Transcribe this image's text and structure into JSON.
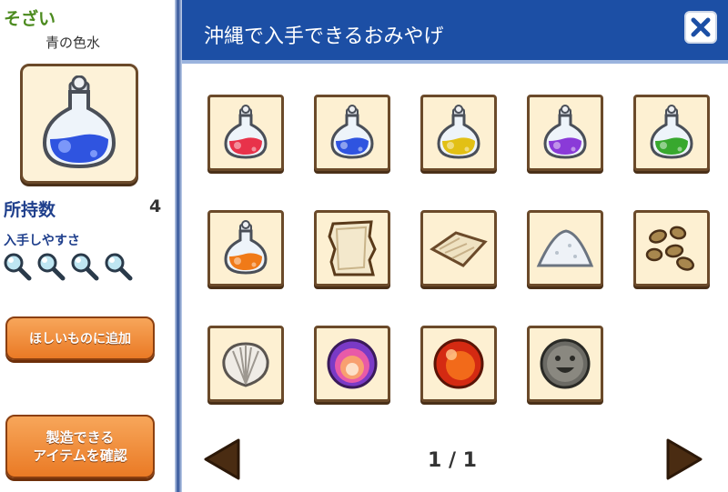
{
  "left": {
    "category": "そざい",
    "item_name": "青の色水",
    "owned_label": "所持数",
    "owned_value": "4",
    "ease_label": "入手しやすさ",
    "ease_level": 4,
    "wishlist_button": "ほしいものに追加",
    "craft_button_line1": "製造できる",
    "craft_button_line2": "アイテムを確認"
  },
  "header": {
    "title": "沖縄で入手できるおみやげ",
    "close_icon": "close-x-icon"
  },
  "items": [
    {
      "icon": "potion-red-icon",
      "color": "#e8324a"
    },
    {
      "icon": "potion-blue-icon",
      "color": "#2f54e0"
    },
    {
      "icon": "potion-yellow-icon",
      "color": "#e2c015"
    },
    {
      "icon": "potion-purple-icon",
      "color": "#8a3ad8"
    },
    {
      "icon": "potion-green-icon",
      "color": "#38a82e"
    },
    {
      "icon": "potion-orange-icon",
      "color": "#f07a18"
    },
    {
      "icon": "parchment-icon"
    },
    {
      "icon": "cloth-icon"
    },
    {
      "icon": "salt-icon"
    },
    {
      "icon": "seeds-icon"
    },
    {
      "icon": "shell-icon"
    },
    {
      "icon": "purple-stone-icon"
    },
    {
      "icon": "red-orb-icon"
    },
    {
      "icon": "smiling-rock-icon"
    }
  ],
  "pager": {
    "text": "1 / 1",
    "prev_icon": "left-arrow-icon",
    "next_icon": "right-arrow-icon"
  },
  "colors": {
    "header_blue": "#1c4fa5",
    "category_green": "#4b8a1e",
    "label_blue": "#1f3f8c",
    "button_orange": "#ea7a25",
    "card_border": "#6b4a2a"
  }
}
